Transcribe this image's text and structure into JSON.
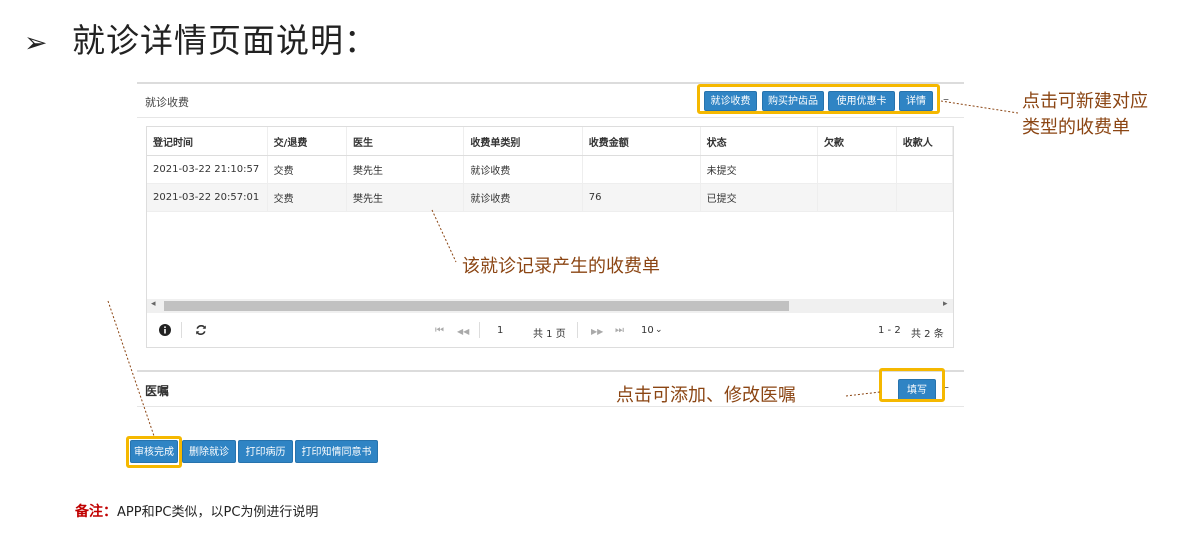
{
  "slide": {
    "bullet": "➢",
    "title": "就诊详情页面说明："
  },
  "panel": {
    "title": "就诊收费",
    "toolbar": [
      "就诊收费",
      "购买护齿品",
      "使用优惠卡",
      "详情"
    ],
    "collapse": "–"
  },
  "table": {
    "columns": [
      "登记时间",
      "交/退费",
      "医生",
      "收费单类别",
      "收费金额",
      "状态",
      "欠款",
      "收款人"
    ],
    "rows": [
      [
        "2021-03-22 21:10:57",
        "交费",
        "樊先生",
        "就诊收费",
        "",
        "未提交",
        "",
        ""
      ],
      [
        "2021-03-22 20:57:01",
        "交费",
        "樊先生",
        "就诊收费",
        "76",
        "已提交",
        "",
        ""
      ]
    ],
    "scroll_left": "◂",
    "scroll_right": "▸"
  },
  "pager": {
    "info_icon": "info-icon",
    "refresh_icon": "refresh-icon",
    "first": "⏮",
    "prev": "◀◀",
    "page": "1",
    "total_pages": "共 1 页",
    "next": "▶▶",
    "last": "⏭",
    "page_size": "10",
    "range": "1 - 2",
    "total": "共 2 条"
  },
  "orders": {
    "title": "医嘱",
    "fill_button": "填写",
    "collapse": "–"
  },
  "bottom_buttons": [
    "审核完成",
    "删除就诊",
    "打印病历",
    "打印知情同意书"
  ],
  "callouts": {
    "toolbar": [
      "点击可新建对应",
      "类型的收费单"
    ],
    "table": "该就诊记录产生的收费单",
    "orders": "点击可添加、修改医嘱"
  },
  "note": {
    "label": "备注：",
    "text": "APP和PC类似，以PC为例进行说明"
  },
  "colors": {
    "button": "#2f84c4",
    "highlight": "#f5b800",
    "callout": "#8b4513",
    "note_label": "#c00000"
  }
}
